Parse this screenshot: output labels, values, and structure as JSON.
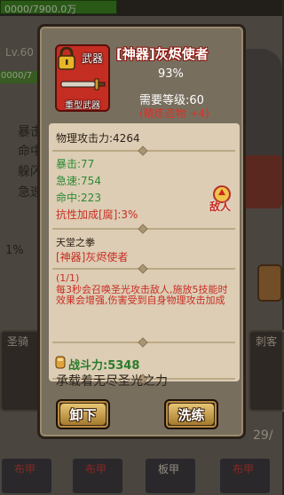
{
  "background": {
    "hp_text": "0000/7900.0万",
    "level_text": "Lv.60",
    "exp_text": "0000/7",
    "stats": [
      "暴击",
      "命中",
      "躲闪",
      "急速"
    ],
    "percent": "1%",
    "cards": [
      "圣骑",
      "刺客"
    ],
    "page_counter": "29/",
    "bottom_slots": [
      "布甲",
      "布甲",
      "板甲",
      "布甲"
    ]
  },
  "item": {
    "slot_type": "武器",
    "icon_name": "重型武器",
    "title": "[神器]灰烬使者",
    "percent": "93%",
    "required_level": "需要等级:60",
    "refine": "(精炼造物 +4)",
    "physical_attack": "物理攻击力:4264",
    "crit": "暴击:77",
    "haste": "急速:754",
    "hit": "命中:223",
    "resist_bonus": "抗性加成[腐]:3%",
    "enemy_badge": "敌人",
    "set_name": "天堂之拳",
    "set_item": "[神器]灰烬使者",
    "set_count": "(1/1)",
    "description": "每3秒会召唤圣光攻击敌人,施放5技能时效果会增强,伤害受到自身物理攻击加成",
    "power_label": "战斗力:",
    "power_value": "5348",
    "flavor_text": "承载着无尽圣光之力"
  },
  "buttons": {
    "unequip": "卸下",
    "reroll": "洗练"
  }
}
